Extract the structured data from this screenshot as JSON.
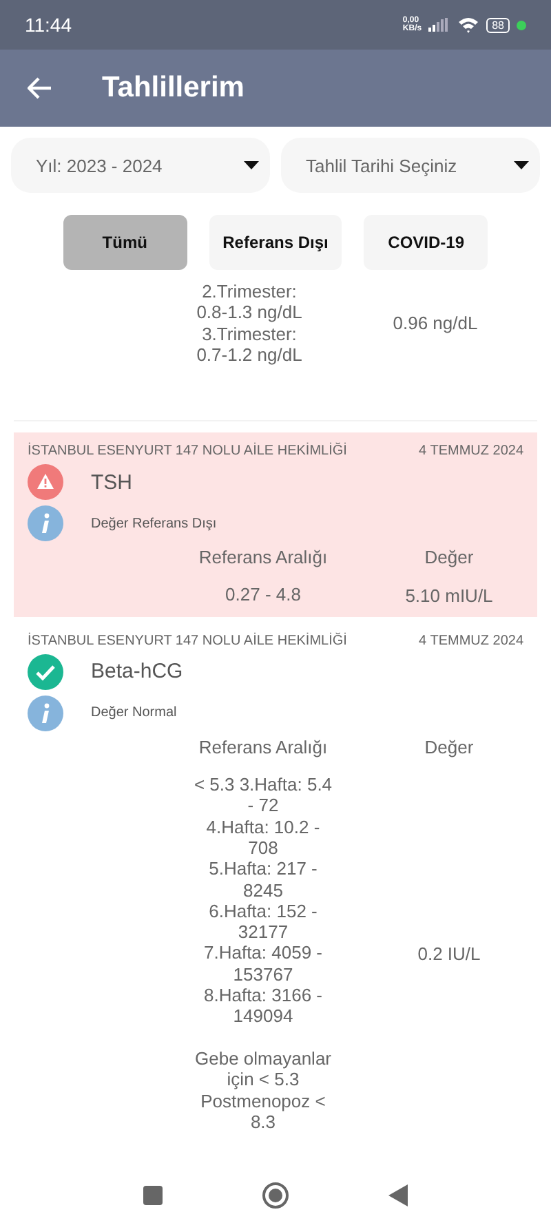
{
  "status_bar": {
    "time": "11:44",
    "net_speed": "0,00",
    "net_unit": "KB/s",
    "battery": "88"
  },
  "app_bar": {
    "title": "Tahlillerim"
  },
  "filters": [
    {
      "value": "Yıl: 2023 - 2024"
    },
    {
      "value": "Tahlil Tarihi Seçiniz"
    }
  ],
  "chips": [
    {
      "label": "Tümü",
      "selected": true
    },
    {
      "label": "Referans Dışı",
      "selected": false
    },
    {
      "label": "COVID-19",
      "selected": false
    }
  ],
  "results": [
    {
      "kind": "continued",
      "reference": "2.Trimester:\n0.8-1.3 ng/dL\n3.Trimester:\n0.7-1.2 ng/dL",
      "value": "0.96 ng/dL"
    },
    {
      "kind": "result",
      "lab": "İSTANBUL ESENYURT 147 NOLU AİLE HEKİMLİĞİ",
      "date": "4 TEMMUZ 2024",
      "name": "TSH",
      "out_of_range": true,
      "status": "Değer Referans Dışı",
      "reference_label": "Referans Aralığı",
      "value_label": "Değer",
      "reference": "0.27 - 4.8",
      "value": "5.10 mIU/L"
    },
    {
      "kind": "result",
      "lab": "İSTANBUL ESENYURT 147 NOLU AİLE HEKİMLİĞİ",
      "date": "4 TEMMUZ 2024",
      "name": "Beta-hCG",
      "out_of_range": false,
      "status": "Değer Normal",
      "reference_label": "Referans Aralığı",
      "value_label": "Değer",
      "reference": "< 5.3  3.Hafta: 5.4\n- 72\n4.Hafta: 10.2 -\n708\n5.Hafta: 217 -\n8245\n6.Hafta: 152 -\n32177\n7.Hafta: 4059 -\n153767\n8.Hafta: 3166 -\n149094\n\nGebe olmayanlar\niçin < 5.3\nPostmenopoz   <\n8.3",
      "value": "0.2 IU/L"
    }
  ]
}
